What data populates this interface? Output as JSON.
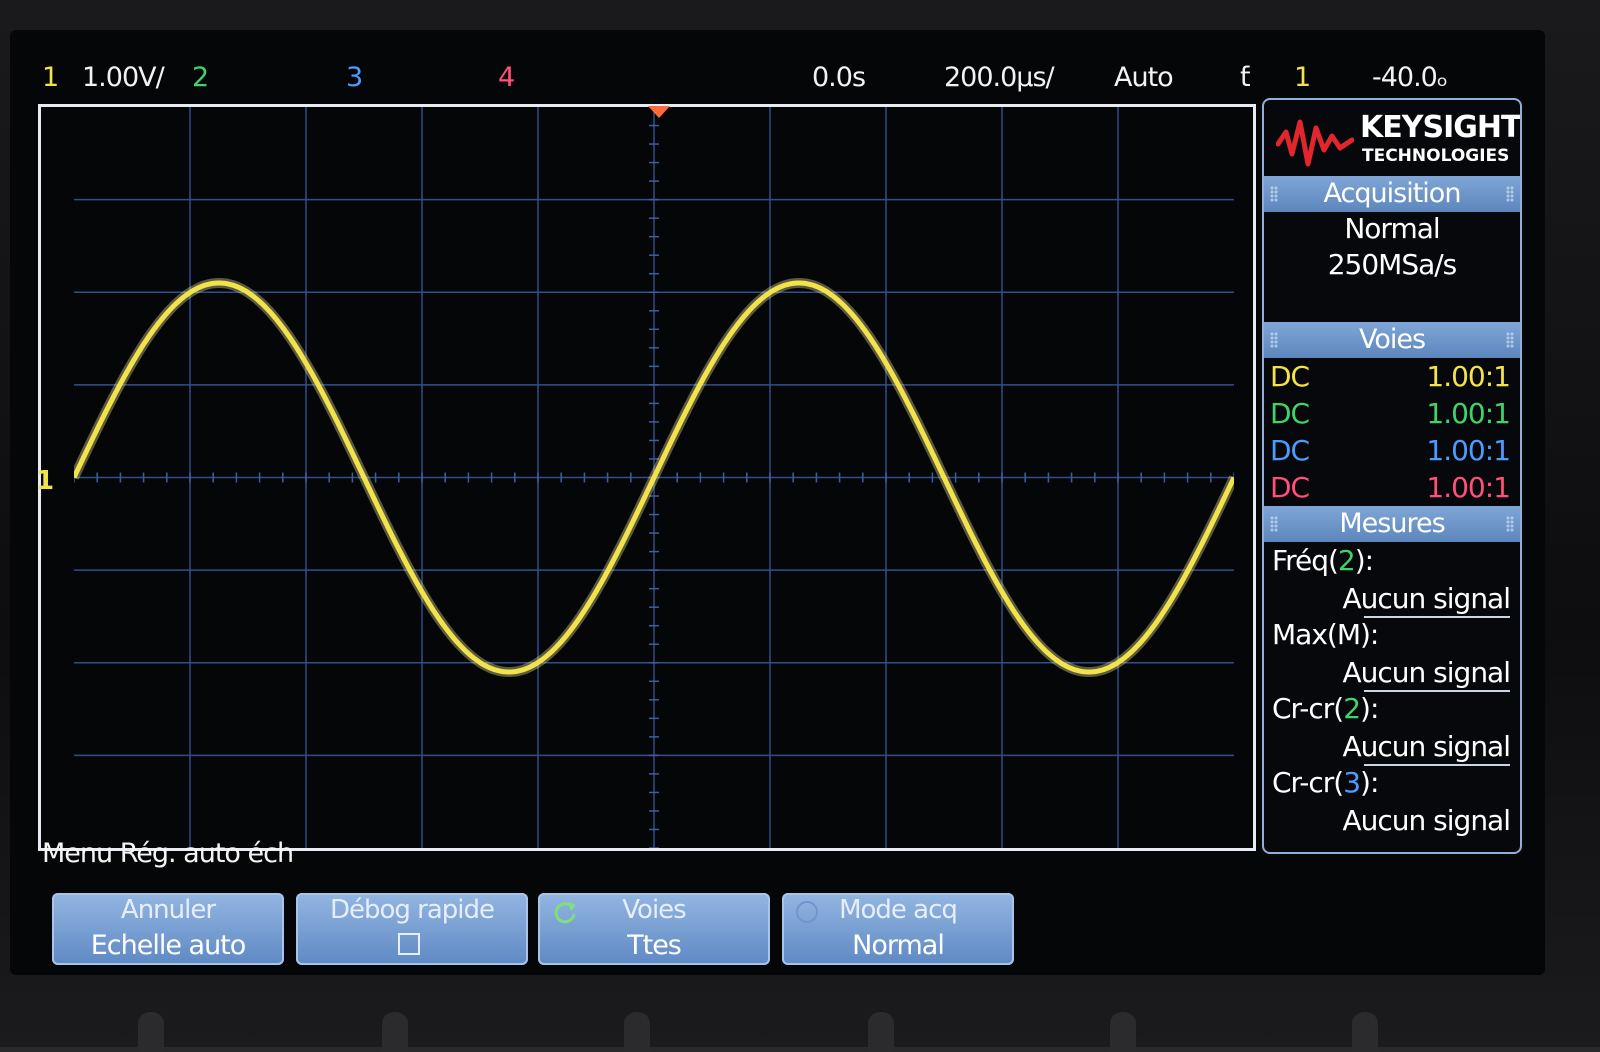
{
  "status_bar": {
    "ch1_num": "1",
    "ch1_scale": "1.00V/",
    "ch2_num": "2",
    "ch3_num": "3",
    "ch4_num": "4",
    "time_offset": "0.0s",
    "time_scale": "200.0µs/",
    "trigger_mode": "Auto",
    "trigger_symbol": "ƭ",
    "trigger_source": "1",
    "trigger_level": "-40.0ₒ"
  },
  "graticule": {
    "ground_marker": "1",
    "signal": {
      "channel": 1,
      "cycles_on_screen": 2,
      "amplitude_div": 2.1,
      "phase_start": 0
    }
  },
  "panel": {
    "brand": "KEYSIGHT",
    "brand_sub": "TECHNOLOGIES",
    "acquisition": {
      "header": "Acquisition",
      "mode": "Normal",
      "rate": "250MSa/s"
    },
    "voies": {
      "header": "Voies",
      "rows": [
        {
          "coupling": "DC",
          "probe": "1.00:1",
          "color": "#f2e34a"
        },
        {
          "coupling": "DC",
          "probe": "1.00:1",
          "color": "#3fd36b"
        },
        {
          "coupling": "DC",
          "probe": "1.00:1",
          "color": "#4c9cff"
        },
        {
          "coupling": "DC",
          "probe": "1.00:1",
          "color": "#ff4f7a"
        }
      ]
    },
    "mesures": {
      "header": "Mesures",
      "items": [
        {
          "label_pre": "Fréq(",
          "label_src": "2",
          "label_post": "):",
          "value": "Aucun signal",
          "src_color": "#3fd36b"
        },
        {
          "label_pre": "Max(",
          "label_src": "M",
          "label_post": "):",
          "value": "Aucun signal",
          "src_color": "#ffffff"
        },
        {
          "label_pre": "Cr-cr(",
          "label_src": "2",
          "label_post": "):",
          "value": "Aucun signal",
          "src_color": "#3fd36b"
        },
        {
          "label_pre": "Cr-cr(",
          "label_src": "3",
          "label_post": "):",
          "value": "Aucun signal",
          "src_color": "#4c9cff"
        }
      ]
    }
  },
  "menu": {
    "title": "Menu Rég. auto éch",
    "softkeys": [
      {
        "line1": "Annuler",
        "line2": "Echelle auto"
      },
      {
        "line1": "Débog rapide",
        "line2": ""
      },
      {
        "line1": "Voies",
        "line2": "Ttes"
      },
      {
        "line1": "Mode acq",
        "line2": "Normal"
      }
    ]
  },
  "colors": {
    "ch1": "#f2e34a",
    "ch2": "#3fd36b",
    "ch3": "#4c9cff",
    "ch4": "#ff4f7a",
    "grid": "#2f4f8c",
    "accent": "#6a90c8"
  }
}
